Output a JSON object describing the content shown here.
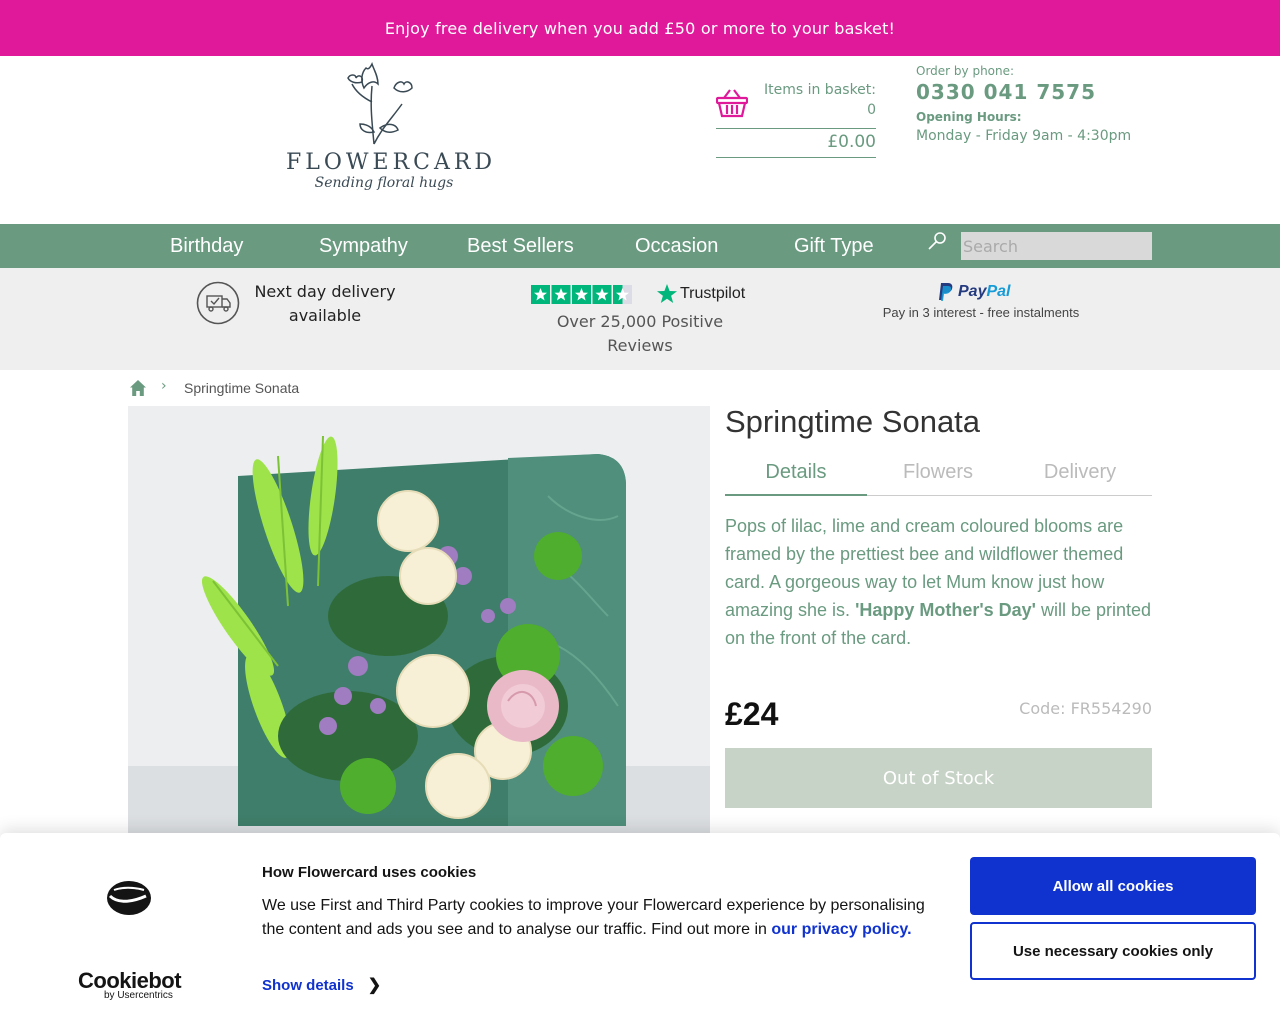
{
  "promo": {
    "text": "Enjoy free delivery when you add £50 or more to your basket!"
  },
  "header": {
    "logo_name": "FLOWERCARD",
    "logo_tagline": "Sending floral hugs",
    "basket": {
      "label": "Items in basket:",
      "count": "0",
      "total": "£0.00",
      "icon": "basket-icon"
    },
    "phone": {
      "label": "Order by phone:",
      "number": "0330 041 7575",
      "hours_label": "Opening Hours:",
      "hours": "Monday - Friday 9am - 4:30pm"
    }
  },
  "nav": {
    "items": [
      "Birthday",
      "Sympathy",
      "Best Sellers",
      "Occasion",
      "Gift Type"
    ],
    "search_placeholder": "Search",
    "search_icon": "search-icon"
  },
  "usp": {
    "delivery": "Next day delivery available",
    "trustpilot_brand": "Trustpilot",
    "trustpilot_text": "Over 25,000 Positive Reviews",
    "trustpilot_rating": 4.5,
    "paypal_brand_a": "Pay",
    "paypal_brand_b": "Pal",
    "paypal_text": "Pay in 3 interest - free instalments"
  },
  "breadcrumb": {
    "home_icon": "home-icon",
    "current": "Springtime Sonata"
  },
  "product": {
    "title": "Springtime Sonata",
    "tabs": [
      "Details",
      "Flowers",
      "Delivery"
    ],
    "active_tab": "Details",
    "description_pre": "Pops of lilac, lime and cream coloured blooms are framed by the prettiest bee and wildflower themed card. A gorgeous way to let Mum know just how amazing she is. ",
    "description_bold": "'Happy Mother's Day'",
    "description_post": " will be printed on the front of the card.",
    "price": "£24",
    "code": "Code: FR554290",
    "stock_button": "Out of Stock"
  },
  "cookie": {
    "brand": "Cookiebot",
    "brand_sub": "by Usercentrics",
    "title": "How Flowercard uses cookies",
    "text": "We use First and Third Party cookies to improve your Flowercard experience by personalising the content and ads you see and to analyse our traffic. Find out more in ",
    "link": "our privacy policy.",
    "show_details": "Show details",
    "allow_all": "Allow all cookies",
    "necessary_only": "Use necessary cookies only"
  },
  "colors": {
    "promo_bg": "#e0199a",
    "brand_green": "#6a9a80",
    "cookie_blue": "#1032cf",
    "stock_button_bg": "#c8d3c8"
  }
}
